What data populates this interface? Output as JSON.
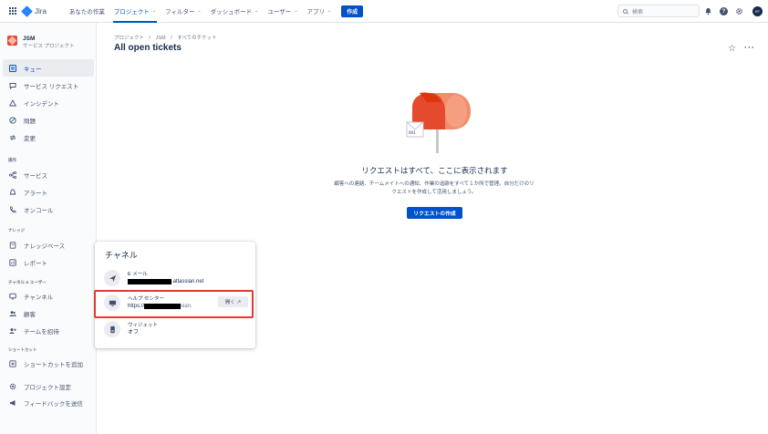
{
  "topnav": {
    "logo": "Jira",
    "items": [
      {
        "label": "あなたの作業",
        "chevron": false,
        "active": false
      },
      {
        "label": "プロジェクト",
        "chevron": true,
        "active": true
      },
      {
        "label": "フィルター",
        "chevron": true,
        "active": false
      },
      {
        "label": "ダッシュボード",
        "chevron": true,
        "active": false
      },
      {
        "label": "ユーザー",
        "chevron": true,
        "active": false
      },
      {
        "label": "アプリ",
        "chevron": true,
        "active": false
      }
    ],
    "create": "作成",
    "search_placeholder": "検索",
    "avatar_initials": "RT"
  },
  "project": {
    "name": "JSM",
    "type": "サービス プロジェクト"
  },
  "sidebar": {
    "items": [
      {
        "label": "キュー",
        "icon": "queue-icon",
        "active": true
      },
      {
        "label": "サービス リクエスト",
        "icon": "chat-icon",
        "active": false
      },
      {
        "label": "インシデント",
        "icon": "warning-icon",
        "active": false
      },
      {
        "label": "問題",
        "icon": "block-icon",
        "active": false
      },
      {
        "label": "変更",
        "icon": "change-icon",
        "active": false
      }
    ],
    "sections": [
      {
        "title": "操作",
        "items": [
          {
            "label": "サービス",
            "icon": "services-icon"
          },
          {
            "label": "アラート",
            "icon": "bell-icon"
          },
          {
            "label": "オンコール",
            "icon": "oncall-icon"
          }
        ]
      },
      {
        "title": "ナレッジ",
        "items": [
          {
            "label": "ナレッジベース",
            "icon": "book-icon"
          },
          {
            "label": "レポート",
            "icon": "chart-icon"
          }
        ]
      },
      {
        "title": "チャネル & ユーザー",
        "items": [
          {
            "label": "チャンネル",
            "icon": "channel-icon"
          },
          {
            "label": "顧客",
            "icon": "customers-icon"
          },
          {
            "label": "チームを招待",
            "icon": "invite-icon"
          }
        ]
      },
      {
        "title": "ショートカット",
        "items": [
          {
            "label": "ショートカットを追加",
            "icon": "add-link-icon"
          }
        ]
      }
    ],
    "footer": [
      {
        "label": "プロジェクト設定",
        "icon": "settings-icon"
      },
      {
        "label": "フィードバックを送信",
        "icon": "megaphone-icon"
      }
    ]
  },
  "breadcrumb": [
    "プロジェクト",
    "/",
    "JSM",
    "/",
    "すべてのチケット"
  ],
  "page_title": "All open tickets",
  "empty_state": {
    "heading": "リクエストはすべて、ここに表示されます",
    "body": "顧客への連絡、チームメイトへの通知、作業の追跡をすべて１か所で管理。自分だけのリクエストを作成して活用しましょう。",
    "button": "リクエストの作成"
  },
  "channels": {
    "title": "チャネル",
    "items": [
      {
        "label": "E メール",
        "value_suffix": ".atlassian.net",
        "icon": "send-icon"
      },
      {
        "label": "ヘルプ センター",
        "value_prefix": "https://",
        "value_suffix": "sian.",
        "icon": "monitor-icon",
        "action": "開く ↗"
      },
      {
        "label": "ウィジェット",
        "value": "オフ",
        "icon": "widget-icon"
      }
    ]
  },
  "colors": {
    "accent": "#0052cc",
    "highlight": "#e53935"
  }
}
